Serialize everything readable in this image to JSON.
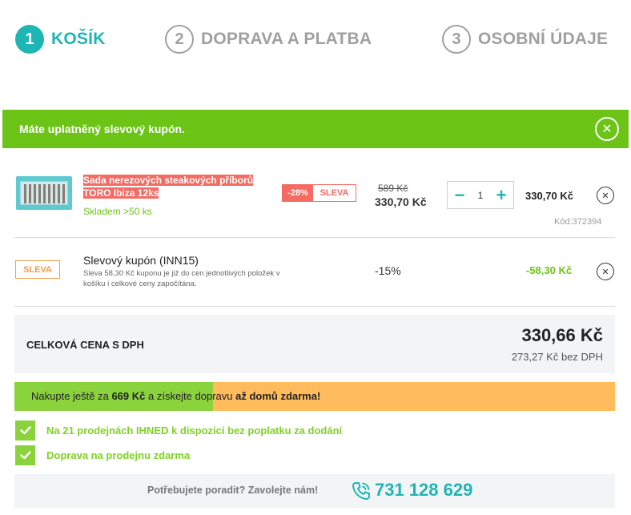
{
  "steps": [
    {
      "num": "1",
      "label": "KOŠÍK"
    },
    {
      "num": "2",
      "label": "DOPRAVA A PLATBA"
    },
    {
      "num": "3",
      "label": "OSOBNÍ ÚDAJE"
    }
  ],
  "banner": {
    "text": "Máte uplatněný slevový kupón.",
    "close_icon": "close-circle-icon",
    "color": "#6cc417"
  },
  "product": {
    "title_line1": "Sada nerezových steakových příborů",
    "title_line2": "TORO Ibiza 12ks",
    "stock": "Skladem >50 ks",
    "discount_pct": "-28%",
    "discount_label": "SLEVA",
    "old_price": "589 Kč",
    "new_price": "330,70 Kč",
    "qty": "1",
    "qty_minus": "−",
    "qty_plus": "+",
    "line_total": "330,70 Kč",
    "code": "Kód:372394"
  },
  "coupon": {
    "badge": "SLEVA",
    "title": "Slevový kupón (INN15)",
    "desc": "Sleva 58,30 Kč kuponu je již do cen jednotlivých položek v košíku i celkové ceny započítána.",
    "pct": "-15%",
    "amount": "-58,30 Kč"
  },
  "total": {
    "label": "CELKOVÁ CENA S DPH",
    "price": "330,66 Kč",
    "net": "273,27 Kč bez DPH"
  },
  "shipping": {
    "prefix": "Nakupte ještě za ",
    "amount": "669 Kč",
    "middle": " a získejte dopravu ",
    "suffix": "až domů zdarma!",
    "progress_pct": 33
  },
  "benefits": [
    "Na 21 prodejnách IHNED k dispozici bez poplatku za dodání",
    "Doprava na prodejnu zdarma"
  ],
  "help": {
    "text": "Potřebujete poradit? Zavolejte nám!",
    "phone": "731 128 629",
    "phone_icon": "phone-icon"
  },
  "colors": {
    "accent": "#1eb5b5",
    "green": "#6cc417",
    "sale_red": "#f36b63",
    "sale_orange": "#f39c4b",
    "shipping_orange": "#ffbb5c"
  }
}
